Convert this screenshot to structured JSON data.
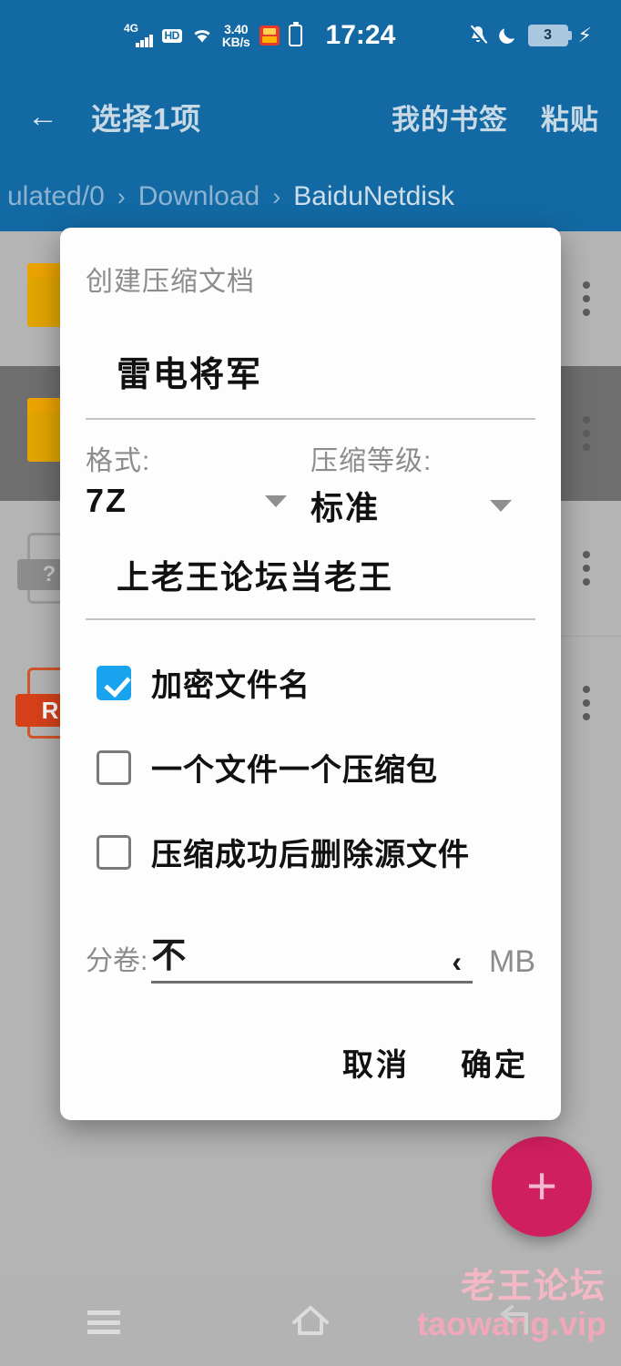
{
  "status_bar": {
    "network_type": "4G",
    "hd_label": "HD",
    "net_speed": "3.40",
    "net_speed_unit": "KB/s",
    "clock": "17:24",
    "battery_level": "3",
    "icons": [
      "signal-bars-icon",
      "hd-icon",
      "wifi-icon",
      "network-speed",
      "app-badge-icon",
      "battery-outline-icon",
      "bell-slash-icon",
      "moon-icon",
      "battery-badge",
      "charging-bolt-icon"
    ],
    "background_color": "#1369a3"
  },
  "app_bar": {
    "back_label": "←",
    "title": "选择1项",
    "actions": [
      {
        "label": "我的书签"
      },
      {
        "label": "粘贴"
      }
    ]
  },
  "breadcrumb": {
    "separator": "›",
    "crumbs": [
      {
        "label": "ulated/0",
        "current": false
      },
      {
        "label": "Download",
        "current": false
      },
      {
        "label": "BaiduNetdisk",
        "current": true
      }
    ]
  },
  "file_list": {
    "rows": [
      {
        "icon": "folder-icon",
        "selected": false
      },
      {
        "icon": "folder-icon",
        "selected": true
      },
      {
        "icon": "unknown-file-icon",
        "badge": "?",
        "selected": false
      },
      {
        "icon": "rar-file-icon",
        "badge": "R",
        "selected": false
      }
    ],
    "overflow_icon": "kebab-menu-icon"
  },
  "fab": {
    "icon": "plus-icon",
    "label": "+",
    "color": "#d01f5e"
  },
  "watermark": {
    "line1": "老王论坛",
    "line2": "taowang.vip",
    "color": "#f3b8c4"
  },
  "nav_bar": {
    "recents_icon": "hamburger-icon",
    "home_icon": "home-icon",
    "back_icon": "back-arrow-icon"
  },
  "dialog": {
    "title": "创建压缩文档",
    "filename_value": "雷电将军",
    "format": {
      "label": "格式:",
      "value": "7Z",
      "dropdown_icon": "chevron-down-icon"
    },
    "level": {
      "label": "压缩等级:",
      "value": "标准",
      "dropdown_icon": "chevron-down-icon"
    },
    "password_value": "上老王论坛当老王",
    "checkboxes": [
      {
        "label": "加密文件名",
        "checked": true
      },
      {
        "label": "一个文件一个压缩包",
        "checked": false
      },
      {
        "label": "压缩成功后删除源文件",
        "checked": false
      }
    ],
    "split": {
      "label": "分卷:",
      "value": "不",
      "caret": "‹",
      "unit": "MB"
    },
    "buttons": {
      "cancel": "取消",
      "confirm": "确定"
    },
    "checkbox_accent": "#19a3ef"
  }
}
